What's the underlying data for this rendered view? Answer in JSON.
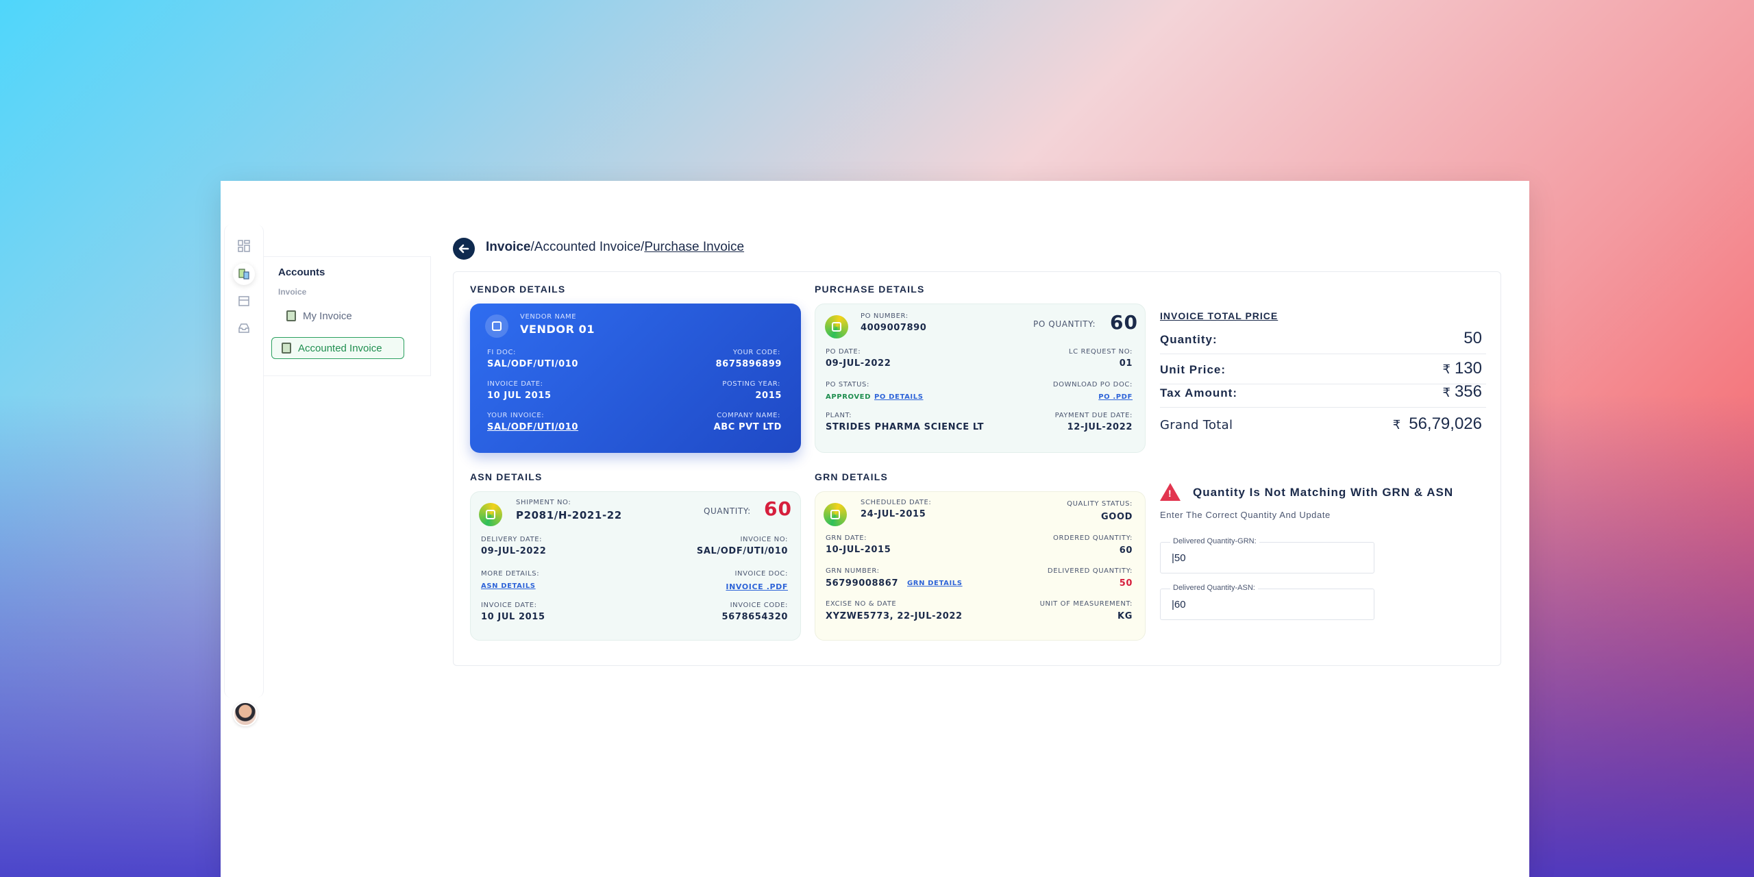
{
  "breadcrumb": {
    "part1": "Invoice",
    "sep1": "/",
    "part2": "Accounted Invoice",
    "sep2": "/",
    "part3": "Purchase Invoice"
  },
  "sidebar": {
    "title": "Accounts",
    "subtitle": "Invoice",
    "items": [
      {
        "label": "My Invoice",
        "active": false
      },
      {
        "label": "Accounted Invoice",
        "active": true
      }
    ]
  },
  "vendor": {
    "section_title": "VENDOR DETAILS",
    "name_label": "VENDOR NAME",
    "name": "VENDOR 01",
    "fi_doc_label": "FI DOC:",
    "fi_doc": "SAL/ODF/UTI/010",
    "your_code_label": "YOUR CODE:",
    "your_code": "8675896899",
    "invoice_date_label": "INVOICE DATE:",
    "invoice_date": "10 JUL 2015",
    "posting_year_label": "POSTING YEAR:",
    "posting_year": "2015",
    "your_invoice_label": "YOUR INVOICE:",
    "your_invoice": "SAL/ODF/UTI/010",
    "company_name_label": "COMPANY NAME:",
    "company_name": "ABC PVT LTD"
  },
  "purchase": {
    "section_title": "PURCHASE DETAILS",
    "po_number_label": "PO NUMBER:",
    "po_number": "4009007890",
    "po_quantity_label": "PO QUANTITY:",
    "po_quantity": "60",
    "po_date_label": "PO DATE:",
    "po_date": "09-JUL-2022",
    "lc_request_label": "LC REQUEST NO:",
    "lc_request": "01",
    "po_status_label": "PO STATUS:",
    "po_status": "APPROVED",
    "po_details_link": "PO DETAILS",
    "download_label": "DOWNLOAD PO DOC:",
    "download_link": "PO .PDF",
    "plant_label": "PLANT:",
    "plant": "STRIDES PHARMA SCIENCE LT",
    "payment_due_label": "PAYMENT DUE DATE:",
    "payment_due": "12-JUL-2022"
  },
  "asn": {
    "section_title": "ASN DETAILS",
    "shipment_label": "SHIPMENT NO:",
    "shipment": "P2081/H-2021-22",
    "quantity_label": "QUANTITY:",
    "quantity": "60",
    "delivery_date_label": "DELIVERY DATE:",
    "delivery_date": "09-JUL-2022",
    "invoice_no_label": "INVOICE NO:",
    "invoice_no": "SAL/ODF/UTI/010",
    "more_details_label": "MORE DETAILS:",
    "asn_details_link": "ASN DETAILS",
    "invoice_doc_label": "INVOICE DOC:",
    "invoice_doc_link": "INVOICE .PDF",
    "invoice_date_label": "INVOICE DATE:",
    "invoice_date": "10 JUL 2015",
    "invoice_code_label": "INVOICE CODE:",
    "invoice_code": "5678654320"
  },
  "grn": {
    "section_title": "GRN DETAILS",
    "scheduled_label": "SCHEDULED DATE:",
    "scheduled": "24-JUL-2015",
    "quality_label": "QUALITY STATUS:",
    "quality": "GOOD",
    "grn_date_label": "GRN DATE:",
    "grn_date": "10-JUL-2015",
    "ordered_label": "ORDERED QUANTITY:",
    "ordered": "60",
    "grn_number_label": "GRN NUMBER:",
    "grn_number": "56799008867",
    "grn_details_link": "GRN DETAILS",
    "delivered_label": "DELIVERED QUANTITY:",
    "delivered": "50",
    "excise_label": "EXCISE NO & DATE",
    "excise": "XYZWE5773, 22-JUL-2022",
    "uom_label": "UNIT OF MEASUREMENT:",
    "uom": "KG"
  },
  "totals": {
    "title": "INVOICE TOTAL PRICE",
    "currency_symbol": "₹",
    "quantity_label": "Quantity:",
    "quantity": "50",
    "unit_price_label": "Unit Price:",
    "unit_price": "130",
    "tax_label": "Tax Amount:",
    "tax": "356",
    "grand_total_label": "Grand Total",
    "grand_total": "56,79,026"
  },
  "warning": {
    "icon_glyph": "!",
    "title": "Quantity Is Not Matching With GRN & ASN",
    "subtitle": "Enter The Correct Quantity And Update",
    "grn_field_label": "Delivered Quantity-GRN:",
    "grn_field_value": "|50",
    "asn_field_label": "Delivered Quantity-ASN:",
    "asn_field_value": "|60"
  },
  "colors": {
    "accent_blue": "#2f6df0",
    "navy": "#0f2a4f",
    "green": "#1f8e4f",
    "alert_red": "#e2354f"
  }
}
